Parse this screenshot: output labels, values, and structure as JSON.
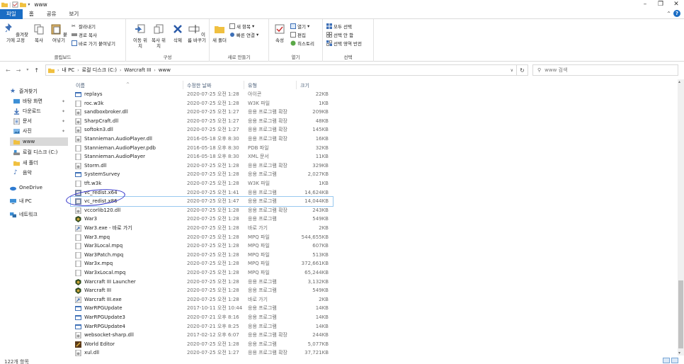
{
  "title": "www",
  "tabs": [
    "파일",
    "홈",
    "공유",
    "보기"
  ],
  "ribbon": {
    "clipboard": {
      "label": "클립보드",
      "pin": "즐겨찾기에 고정",
      "copy": "복사",
      "paste": "붙여넣기",
      "cut": "잘라내기",
      "copy_path": "경로 복사",
      "paste_shortcut": "바로 가기 붙여넣기"
    },
    "organize": {
      "label": "구성",
      "move": "이동 위치",
      "copy_to": "복사 위치",
      "delete": "삭제",
      "rename": "이름 바꾸기"
    },
    "new": {
      "label": "새로 만들기",
      "new_folder": "새 폴더",
      "new_item": "새 항목",
      "easy_access": "빠른 연결"
    },
    "open": {
      "label": "열기",
      "properties": "속성",
      "open": "열기",
      "edit": "편집",
      "history": "히스토리"
    },
    "select": {
      "label": "선택",
      "select_all": "모두 선택",
      "select_none": "선택 안 함",
      "invert": "선택 영역 반전"
    }
  },
  "address": {
    "crumbs": [
      "내 PC",
      "로컬 디스크 (C:)",
      "Warcraft III",
      "www"
    ],
    "search_placeholder": "www 검색"
  },
  "nav": [
    {
      "label": "즐겨찾기",
      "icon": "star-icon",
      "pinned": false
    },
    {
      "label": "바탕 화면",
      "icon": "desktop-icon",
      "pinned": true
    },
    {
      "label": "다운로드",
      "icon": "download-icon",
      "pinned": true
    },
    {
      "label": "문서",
      "icon": "document-icon",
      "pinned": true
    },
    {
      "label": "사진",
      "icon": "picture-icon",
      "pinned": true
    },
    {
      "label": "www",
      "icon": "folder-icon",
      "pinned": false
    },
    {
      "label": "로컬 디스크 (C:)",
      "icon": "drive-icon",
      "pinned": false
    },
    {
      "label": "새 폴더",
      "icon": "folder-icon",
      "pinned": false
    },
    {
      "label": "음악",
      "icon": "music-icon",
      "pinned": false
    },
    {
      "label": "OneDrive",
      "icon": "cloud-icon",
      "pinned": false
    },
    {
      "label": "내 PC",
      "icon": "pc-icon",
      "pinned": false
    },
    {
      "label": "네트워크",
      "icon": "network-icon",
      "pinned": false
    }
  ],
  "columns": [
    "이름",
    "수정한 날짜",
    "유형",
    "크기"
  ],
  "files": [
    {
      "name": "replays",
      "date": "2020-07-25 오전 1:28",
      "type": "아이콘",
      "size": "22KB",
      "icon": "app"
    },
    {
      "name": "roc.w3k",
      "date": "2020-07-25 오전 1:28",
      "type": "W3K 파일",
      "size": "1KB",
      "icon": "file"
    },
    {
      "name": "sandboxbroker.dll",
      "date": "2020-07-25 오전 1:27",
      "type": "응용 프로그램 확장",
      "size": "209KB",
      "icon": "dll"
    },
    {
      "name": "SharpCraft.dll",
      "date": "2020-07-25 오전 1:27",
      "type": "응용 프로그램 확장",
      "size": "48KB",
      "icon": "dll"
    },
    {
      "name": "softokn3.dll",
      "date": "2020-07-25 오전 1:27",
      "type": "응용 프로그램 확장",
      "size": "145KB",
      "icon": "dll"
    },
    {
      "name": "Stannieman.AudioPlayer.dll",
      "date": "2016-05-18 오후 8:30",
      "type": "응용 프로그램 확장",
      "size": "16KB",
      "icon": "dll"
    },
    {
      "name": "Stannieman.AudioPlayer.pdb",
      "date": "2016-05-18 오후 8:30",
      "type": "PDB 파일",
      "size": "32KB",
      "icon": "file"
    },
    {
      "name": "Stannieman.AudioPlayer",
      "date": "2016-05-18 오후 8:30",
      "type": "XML 문서",
      "size": "11KB",
      "icon": "file"
    },
    {
      "name": "Storm.dll",
      "date": "2020-07-25 오전 1:28",
      "type": "응용 프로그램 확장",
      "size": "329KB",
      "icon": "dll"
    },
    {
      "name": "SystemSurvey",
      "date": "2020-07-25 오전 1:28",
      "type": "응용 프로그램",
      "size": "2,027KB",
      "icon": "app"
    },
    {
      "name": "tft.w3k",
      "date": "2020-07-25 오전 1:28",
      "type": "W3K 파일",
      "size": "1KB",
      "icon": "file"
    },
    {
      "name": "vc_redist.x64",
      "date": "2020-07-25 오전 1:41",
      "type": "응용 프로그램",
      "size": "14,624KB",
      "icon": "installer"
    },
    {
      "name": "vc_redist.x86",
      "date": "2020-07-25 오전 1:47",
      "type": "응용 프로그램",
      "size": "14,044KB",
      "icon": "installer",
      "focused": true
    },
    {
      "name": "vccorlib120.dll",
      "date": "2020-07-25 오전 1:28",
      "type": "응용 프로그램 확장",
      "size": "243KB",
      "icon": "dll"
    },
    {
      "name": "War3",
      "date": "2020-07-25 오전 1:28",
      "type": "응용 프로그램",
      "size": "549KB",
      "icon": "war3"
    },
    {
      "name": "War3.exe - 바로 가기",
      "date": "2020-07-25 오전 1:28",
      "type": "바로 가기",
      "size": "2KB",
      "icon": "shortcut"
    },
    {
      "name": "War3.mpq",
      "date": "2020-07-25 오전 1:28",
      "type": "MPQ 파일",
      "size": "544,655KB",
      "icon": "file"
    },
    {
      "name": "War3Local.mpq",
      "date": "2020-07-25 오전 1:28",
      "type": "MPQ 파일",
      "size": "607KB",
      "icon": "file"
    },
    {
      "name": "War3Patch.mpq",
      "date": "2020-07-25 오전 1:28",
      "type": "MPQ 파일",
      "size": "513KB",
      "icon": "file"
    },
    {
      "name": "War3x.mpq",
      "date": "2020-07-25 오전 1:28",
      "type": "MPQ 파일",
      "size": "372,661KB",
      "icon": "file"
    },
    {
      "name": "War3xLocal.mpq",
      "date": "2020-07-25 오전 1:28",
      "type": "MPQ 파일",
      "size": "65,244KB",
      "icon": "file"
    },
    {
      "name": "Warcraft III Launcher",
      "date": "2020-07-25 오전 1:28",
      "type": "응용 프로그램",
      "size": "3,132KB",
      "icon": "war3"
    },
    {
      "name": "Warcraft III",
      "date": "2020-07-25 오전 1:28",
      "type": "응용 프로그램",
      "size": "549KB",
      "icon": "war3"
    },
    {
      "name": "Warcraft III.exe",
      "date": "2020-07-25 오전 1:28",
      "type": "바로 가기",
      "size": "2KB",
      "icon": "shortcut"
    },
    {
      "name": "WarRPGUpdate",
      "date": "2017-10-11 오전 10:44",
      "type": "응용 프로그램",
      "size": "14KB",
      "icon": "app"
    },
    {
      "name": "WarRPGUpdate3",
      "date": "2020-07-21 오후 8:16",
      "type": "응용 프로그램",
      "size": "14KB",
      "icon": "app"
    },
    {
      "name": "WarRPGUpdate4",
      "date": "2020-07-21 오후 8:25",
      "type": "응용 프로그램",
      "size": "14KB",
      "icon": "app"
    },
    {
      "name": "websocket-sharp.dll",
      "date": "2017-02-12 오후 6:07",
      "type": "응용 프로그램 확장",
      "size": "244KB",
      "icon": "dll"
    },
    {
      "name": "World Editor",
      "date": "2020-07-25 오전 1:28",
      "type": "응용 프로그램",
      "size": "5,077KB",
      "icon": "editor"
    },
    {
      "name": "xul.dll",
      "date": "2020-07-25 오전 1:27",
      "type": "응용 프로그램 확장",
      "size": "37,721KB",
      "icon": "dll"
    }
  ],
  "status": "122개 항목",
  "colors": {
    "accent": "#1a6dc4",
    "annotation": "#2b2bc8",
    "focus": "#99c9ef"
  }
}
